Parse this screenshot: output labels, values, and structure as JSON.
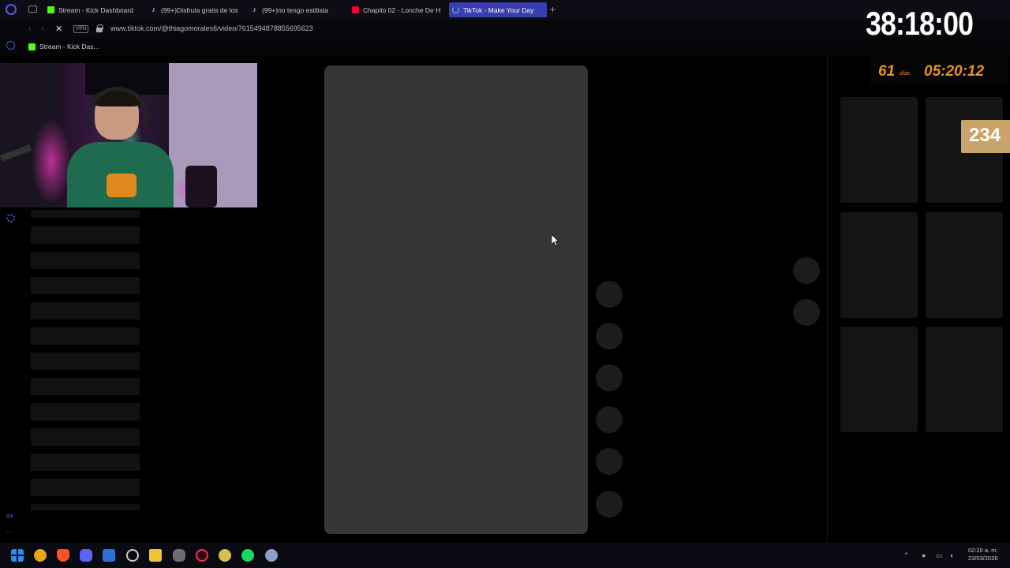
{
  "browser": {
    "tabs": [
      {
        "label": "Stream - Kick Dashboard",
        "icon": "kick-icon"
      },
      {
        "label": "(99+)Disfruta gratis de los",
        "icon": "tiktok-icon"
      },
      {
        "label": "(99+)no tengo estilista",
        "icon": "tiktok-icon"
      },
      {
        "label": "Chapito 02 - Lonche De H",
        "icon": "youtube-icon"
      },
      {
        "label": "TikTok - Make Your Day",
        "icon": "loading-icon",
        "active": true
      }
    ],
    "new_tab_glyph": "+",
    "vpn_label": "VPN",
    "url": "www.tiktok.com/@thiagomorales6/video/7615494878855695623",
    "bookmark": {
      "label": "Stream - Kick Das...",
      "icon": "kick-icon"
    }
  },
  "overlay": {
    "big_timer": "38:18:00",
    "countdown_days": "61",
    "countdown_days_label": "días",
    "countdown_time": "05:20:12",
    "counter": "234"
  },
  "taskbar": {
    "time": "02:20 a. m.",
    "date": "23/03/2026"
  },
  "colors": {
    "accent": "#3a3fb0",
    "kick_green": "#53fc18",
    "countdown_orange": "#e8902a",
    "badge_gold": "#c9a46a"
  }
}
